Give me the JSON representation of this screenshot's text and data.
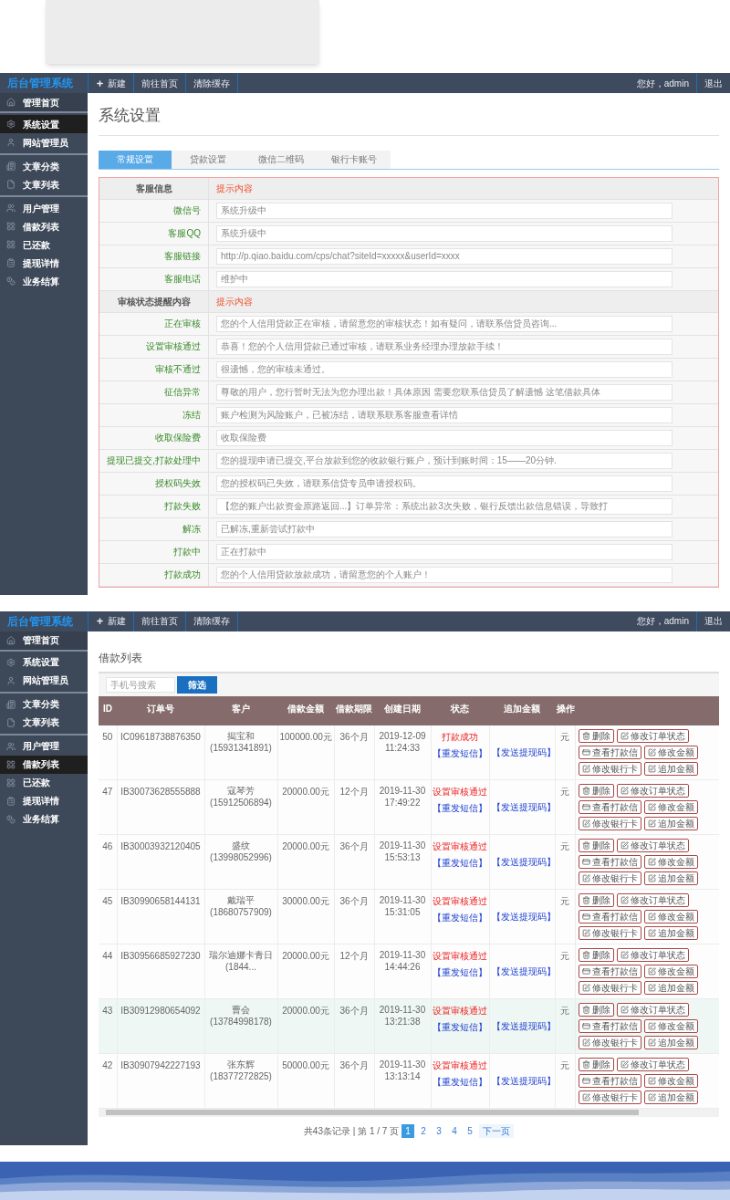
{
  "settings_screen": {
    "nav": {
      "logo": "后台管理系统",
      "actions": [
        "新建",
        "前往首页",
        "清除缓存"
      ],
      "greeting": "您好，admin",
      "logout": "退出"
    },
    "sidebar": {
      "groups": [
        {
          "items": [
            {
              "label": "管理首页",
              "selected": false
            }
          ]
        },
        {
          "items": [
            {
              "label": "系统设置",
              "selected": true
            },
            {
              "label": "网站管理员",
              "selected": false
            }
          ]
        },
        {
          "items": [
            {
              "label": "文章分类",
              "selected": false
            },
            {
              "label": "文章列表",
              "selected": false
            }
          ]
        },
        {
          "items": [
            {
              "label": "用户管理",
              "selected": false
            },
            {
              "label": "借款列表",
              "selected": false
            },
            {
              "label": "已还款",
              "selected": false
            },
            {
              "label": "提现详情",
              "selected": false
            },
            {
              "label": "业务结算",
              "selected": false
            }
          ]
        }
      ]
    },
    "page_title": "系统设置",
    "tabs": [
      {
        "label": "常规设置",
        "selected": true
      },
      {
        "label": "贷款设置",
        "selected": false
      },
      {
        "label": "微信二维码",
        "selected": false
      },
      {
        "label": "银行卡账号",
        "selected": false
      }
    ],
    "form": {
      "sections": [
        {
          "title": "客服信息",
          "hint": "提示内容",
          "fields": [
            {
              "label": "微信号",
              "value": "系统升级中"
            },
            {
              "label": "客服QQ",
              "value": "系统升级中"
            },
            {
              "label": "客服链接",
              "value": "http://p.qiao.baidu.com/cps/chat?siteId=xxxxx&userId=xxxx"
            },
            {
              "label": "客服电话",
              "value": "维护中"
            }
          ]
        },
        {
          "title": "审核状态提醒内容",
          "hint": "提示内容",
          "fields": [
            {
              "label": "正在审核",
              "value": "您的个人信用贷款正在审核，请留意您的审核状态！如有疑问，请联系信贷员咨询..."
            },
            {
              "label": "设置审核通过",
              "value": "恭喜！您的个人信用贷款已通过审核，请联系业务经理办理放款手续！"
            },
            {
              "label": "审核不通过",
              "value": "很遗憾，您的审核未通过。"
            },
            {
              "label": "征信异常",
              "value": "尊敬的用户，您行暂时无法为您办理出款！具体原因 需要您联系信贷员了解遗憾 这笔借款具体"
            },
            {
              "label": "冻结",
              "value": "账户检测为风险账户，已被冻结，请联系联系客服查看详情"
            },
            {
              "label": "收取保险费",
              "value": "收取保险费"
            },
            {
              "label": "提现已提交,打款处理中",
              "value": "您的提现申请已提交,平台放款到您的收款银行账户，预计到账时间：15——20分钟."
            },
            {
              "label": "授权码失效",
              "value": "您的授权码已失效，请联系信贷专员申请授权码。"
            },
            {
              "label": "打款失败",
              "value": "【您的账户出款资金原路返回...】订单异常：系统出款3次失败，银行反馈出款信息错误，导致打"
            },
            {
              "label": "解冻",
              "value": "已解冻,重新尝试打款中"
            },
            {
              "label": "打款中",
              "value": "正在打款中"
            },
            {
              "label": "打款成功",
              "value": "您的个人信用贷款放款成功，请留意您的个人账户！"
            }
          ]
        }
      ]
    }
  },
  "loan_list_screen": {
    "nav": {
      "logo": "后台管理系统",
      "actions": [
        "新建",
        "前往首页",
        "清除缓存"
      ],
      "greeting": "您好，admin",
      "logout": "退出"
    },
    "sidebar": {
      "groups": [
        {
          "items": [
            {
              "label": "管理首页",
              "selected": false
            }
          ]
        },
        {
          "items": [
            {
              "label": "系统设置",
              "selected": false
            },
            {
              "label": "网站管理员",
              "selected": false
            }
          ]
        },
        {
          "items": [
            {
              "label": "文章分类",
              "selected": false
            },
            {
              "label": "文章列表",
              "selected": false
            }
          ]
        },
        {
          "items": [
            {
              "label": "用户管理",
              "selected": false
            },
            {
              "label": "借款列表",
              "selected": true
            },
            {
              "label": "已还款",
              "selected": false
            },
            {
              "label": "提现详情",
              "selected": false
            },
            {
              "label": "业务结算",
              "selected": false
            }
          ]
        }
      ]
    },
    "page_title": "借款列表",
    "search": {
      "placeholder": "手机号搜索",
      "button": "筛选"
    },
    "table": {
      "columns": [
        "ID",
        "订单号",
        "客户",
        "借款金额",
        "借款期限",
        "创建日期",
        "状态",
        "追加金额",
        "操作"
      ],
      "rows": [
        {
          "id": "50",
          "order_no": "IC09618738876350",
          "customer": "揭宝和(15931341891)",
          "amount": "100000.00元",
          "term": "36个月",
          "created": "2019-12-09 11:24:33",
          "status": "打款成功",
          "resend": "【重发短信】",
          "code_link": "【发送提现码】",
          "unit": "元",
          "highlighted": false,
          "buttons": [
            {
              "label": "删除",
              "kind": "delete"
            },
            {
              "label": "修改订单状态",
              "kind": "edit"
            },
            {
              "label": "查看打款信",
              "kind": "view"
            },
            {
              "label": "修改金额",
              "kind": "edit"
            },
            {
              "label": "修改银行卡",
              "kind": "edit"
            },
            {
              "label": "追加金额",
              "kind": "edit"
            }
          ]
        },
        {
          "id": "47",
          "order_no": "IB30073628555888",
          "customer": "寇琴芳(15912506894)",
          "amount": "20000.00元",
          "term": "12个月",
          "created": "2019-11-30 17:49:22",
          "status": "设置审核通过",
          "resend": "【重发短信】",
          "code_link": "【发送提现码】",
          "unit": "元",
          "highlighted": false,
          "buttons": [
            {
              "label": "删除",
              "kind": "delete"
            },
            {
              "label": "修改订单状态",
              "kind": "edit"
            },
            {
              "label": "查看打款信",
              "kind": "view"
            },
            {
              "label": "修改金额",
              "kind": "edit"
            },
            {
              "label": "修改银行卡",
              "kind": "edit"
            },
            {
              "label": "追加金额",
              "kind": "edit"
            }
          ]
        },
        {
          "id": "46",
          "order_no": "IB30003932120405",
          "customer": "盛纹(13998052996)",
          "amount": "20000.00元",
          "term": "36个月",
          "created": "2019-11-30 15:53:13",
          "status": "设置审核通过",
          "resend": "【重发短信】",
          "code_link": "【发送提现码】",
          "unit": "元",
          "highlighted": false,
          "buttons": [
            {
              "label": "删除",
              "kind": "delete"
            },
            {
              "label": "修改订单状态",
              "kind": "edit"
            },
            {
              "label": "查看打款信",
              "kind": "view"
            },
            {
              "label": "修改金额",
              "kind": "edit"
            },
            {
              "label": "修改银行卡",
              "kind": "edit"
            },
            {
              "label": "追加金额",
              "kind": "edit"
            }
          ]
        },
        {
          "id": "45",
          "order_no": "IB30990658144131",
          "customer": "戴瑞平(18680757909)",
          "amount": "30000.00元",
          "term": "36个月",
          "created": "2019-11-30 15:31:05",
          "status": "设置审核通过",
          "resend": "【重发短信】",
          "code_link": "【发送提现码】",
          "unit": "元",
          "highlighted": false,
          "buttons": [
            {
              "label": "删除",
              "kind": "delete"
            },
            {
              "label": "修改订单状态",
              "kind": "edit"
            },
            {
              "label": "查看打款信",
              "kind": "view"
            },
            {
              "label": "修改金额",
              "kind": "edit"
            },
            {
              "label": "修改银行卡",
              "kind": "edit"
            },
            {
              "label": "追加金额",
              "kind": "edit"
            }
          ]
        },
        {
          "id": "44",
          "order_no": "IB30956685927230",
          "customer": "瑞尔迪娜卡青日(1844...",
          "amount": "20000.00元",
          "term": "12个月",
          "created": "2019-11-30 14:44:26",
          "status": "设置审核通过",
          "resend": "【重发短信】",
          "code_link": "【发送提现码】",
          "unit": "元",
          "highlighted": false,
          "buttons": [
            {
              "label": "删除",
              "kind": "delete"
            },
            {
              "label": "修改订单状态",
              "kind": "edit"
            },
            {
              "label": "查看打款信",
              "kind": "view"
            },
            {
              "label": "修改金额",
              "kind": "edit"
            },
            {
              "label": "修改银行卡",
              "kind": "edit"
            },
            {
              "label": "追加金额",
              "kind": "edit"
            }
          ]
        },
        {
          "id": "43",
          "order_no": "IB30912980654092",
          "customer": "曹会(13784998178)",
          "amount": "20000.00元",
          "term": "36个月",
          "created": "2019-11-30 13:21:38",
          "status": "设置审核通过",
          "resend": "【重发短信】",
          "code_link": "【发送提现码】",
          "unit": "元",
          "highlighted": true,
          "buttons": [
            {
              "label": "删除",
              "kind": "delete"
            },
            {
              "label": "修改订单状态",
              "kind": "edit"
            },
            {
              "label": "查看打款信",
              "kind": "view"
            },
            {
              "label": "修改金额",
              "kind": "edit"
            },
            {
              "label": "修改银行卡",
              "kind": "edit"
            },
            {
              "label": "追加金额",
              "kind": "edit"
            }
          ]
        },
        {
          "id": "42",
          "order_no": "IB30907942227193",
          "customer": "张东辉(18377272825)",
          "amount": "50000.00元",
          "term": "36个月",
          "created": "2019-11-30 13:13:14",
          "status": "设置审核通过",
          "resend": "【重发短信】",
          "code_link": "【发送提现码】",
          "unit": "元",
          "highlighted": false,
          "buttons": [
            {
              "label": "删除",
              "kind": "delete"
            },
            {
              "label": "修改订单状态",
              "kind": "edit"
            },
            {
              "label": "查看打款信",
              "kind": "view"
            },
            {
              "label": "修改金额",
              "kind": "edit"
            },
            {
              "label": "修改银行卡",
              "kind": "edit"
            },
            {
              "label": "追加金额",
              "kind": "edit"
            }
          ]
        }
      ]
    },
    "pagination": {
      "summary": "共43条记录 | 第 1 / 7 页",
      "pages": [
        {
          "label": "1",
          "selected": true
        },
        {
          "label": "2",
          "selected": false
        },
        {
          "label": "3",
          "selected": false
        },
        {
          "label": "4",
          "selected": false
        },
        {
          "label": "5",
          "selected": false
        }
      ],
      "next": "下一页"
    }
  }
}
